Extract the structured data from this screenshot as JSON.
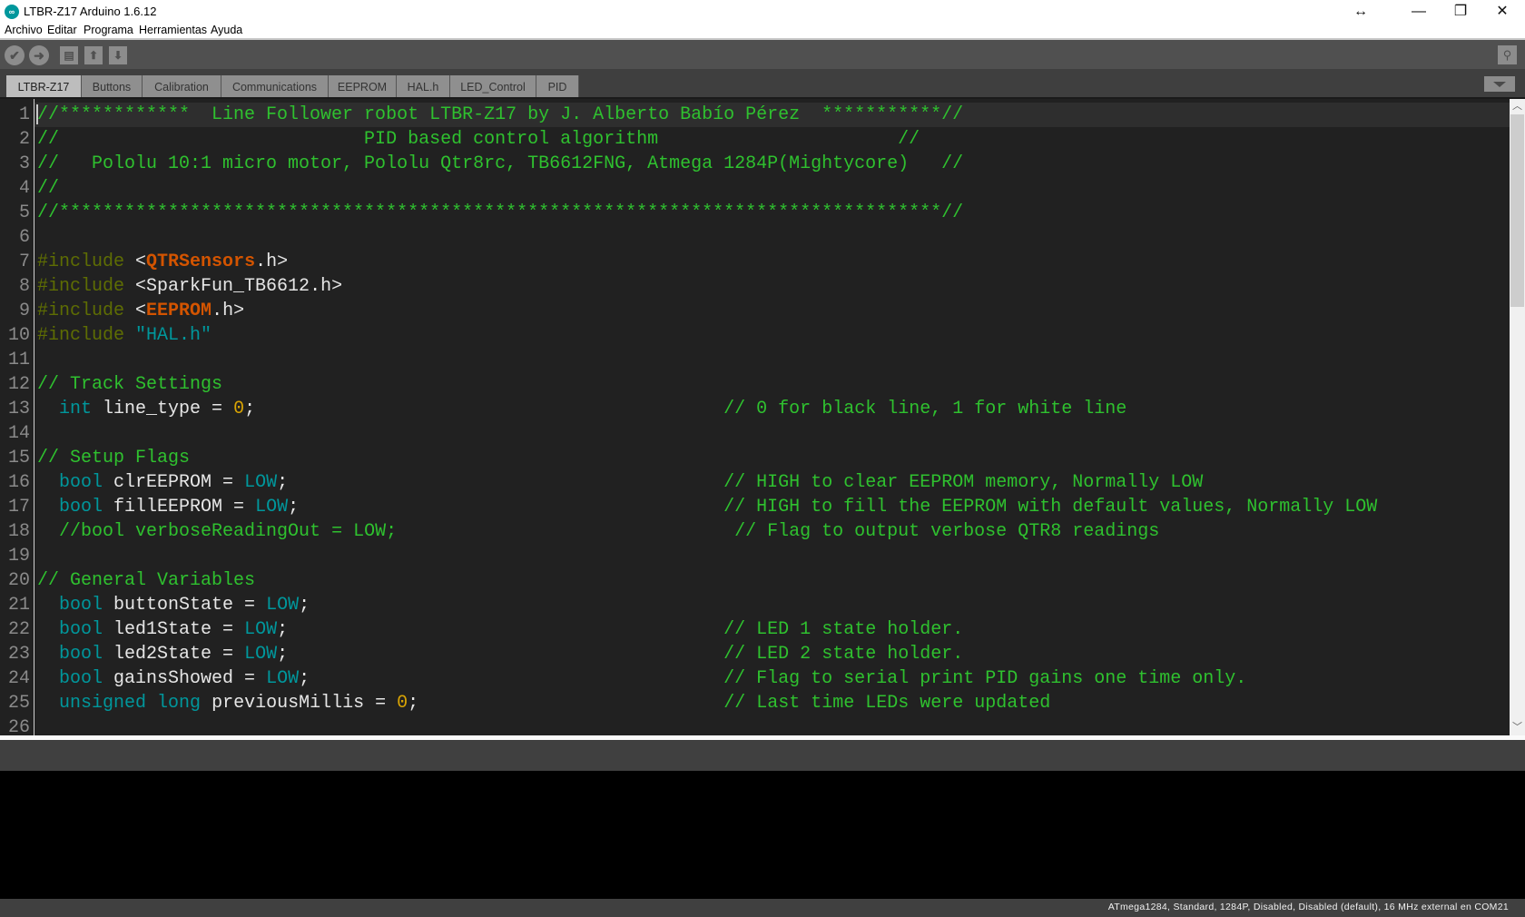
{
  "window": {
    "title": "LTBR-Z17 Arduino 1.6.12",
    "app_icon": "arduino-logo-icon",
    "controls": {
      "resize": "↔",
      "minimize": "—",
      "maximize": "❐",
      "close": "✕"
    }
  },
  "menubar": {
    "items": [
      "Archivo",
      "Editar",
      "Programa",
      "Herramientas",
      "Ayuda"
    ]
  },
  "toolbar": {
    "verify": "✔",
    "upload": "➜",
    "new": "▤",
    "open": "⬆",
    "save": "⬇",
    "serial_monitor": "⚲"
  },
  "tabs": [
    {
      "label": "LTBR-Z17",
      "active": true
    },
    {
      "label": "Buttons"
    },
    {
      "label": "Calibration"
    },
    {
      "label": "Communications"
    },
    {
      "label": "EEPROM"
    },
    {
      "label": "HAL.h"
    },
    {
      "label": "LED_Control"
    },
    {
      "label": "PID"
    }
  ],
  "editor": {
    "line_numbers": [
      "1",
      "2",
      "3",
      "4",
      "5",
      "6",
      "7",
      "8",
      "9",
      "10",
      "11",
      "12",
      "13",
      "14",
      "15",
      "16",
      "17",
      "18",
      "19",
      "20",
      "21",
      "22",
      "23",
      "24",
      "25",
      "26"
    ],
    "lines": [
      [
        [
          "comment",
          "//************  Line Follower robot LTBR-Z17 by J. Alberto Babío Pérez  ***********//"
        ]
      ],
      [
        [
          "comment",
          "//                            PID based control algorithm                      //"
        ]
      ],
      [
        [
          "comment",
          "//   Pololu 10:1 micro motor, Pololu Qtr8rc, TB6612FNG, Atmega 1284P(Mightycore)   //"
        ]
      ],
      [
        [
          "comment",
          "//"
        ]
      ],
      [
        [
          "comment",
          "//*********************************************************************************//"
        ]
      ],
      [],
      [
        [
          "pre",
          "#include "
        ],
        [
          "punct",
          "<"
        ],
        [
          "lib",
          "QTRSensors"
        ],
        [
          "punct",
          ".h>"
        ]
      ],
      [
        [
          "pre",
          "#include "
        ],
        [
          "punct",
          "<SparkFun_TB6612.h>"
        ]
      ],
      [
        [
          "pre",
          "#include "
        ],
        [
          "punct",
          "<"
        ],
        [
          "lib",
          "EEPROM"
        ],
        [
          "punct",
          ".h>"
        ]
      ],
      [
        [
          "pre",
          "#include "
        ],
        [
          "str",
          "\"HAL.h\""
        ]
      ],
      [],
      [
        [
          "comment",
          "// Track Settings"
        ]
      ],
      [
        [
          "punct",
          "  "
        ],
        [
          "kw",
          "int"
        ],
        [
          "id",
          " line_type = "
        ],
        [
          "num",
          "0"
        ],
        [
          "punct",
          ";                                           "
        ],
        [
          "comment",
          "// 0 for black line, 1 for white line"
        ]
      ],
      [],
      [
        [
          "comment",
          "// Setup Flags"
        ]
      ],
      [
        [
          "punct",
          "  "
        ],
        [
          "kw",
          "bool"
        ],
        [
          "id",
          " clrEEPROM = "
        ],
        [
          "kw",
          "LOW"
        ],
        [
          "punct",
          ";                                        "
        ],
        [
          "comment",
          "// HIGH to clear EEPROM memory, Normally LOW"
        ]
      ],
      [
        [
          "punct",
          "  "
        ],
        [
          "kw",
          "bool"
        ],
        [
          "id",
          " fillEEPROM = "
        ],
        [
          "kw",
          "LOW"
        ],
        [
          "punct",
          ";                                       "
        ],
        [
          "comment",
          "// HIGH to fill the EEPROM with default values, Normally LOW"
        ]
      ],
      [
        [
          "punct",
          "  "
        ],
        [
          "comment",
          "//bool verboseReadingOut = LOW;                               // Flag to output verbose QTR8 readings"
        ]
      ],
      [],
      [
        [
          "comment",
          "// General Variables"
        ]
      ],
      [
        [
          "punct",
          "  "
        ],
        [
          "kw",
          "bool"
        ],
        [
          "id",
          " buttonState = "
        ],
        [
          "kw",
          "LOW"
        ],
        [
          "punct",
          ";"
        ]
      ],
      [
        [
          "punct",
          "  "
        ],
        [
          "kw",
          "bool"
        ],
        [
          "id",
          " led1State = "
        ],
        [
          "kw",
          "LOW"
        ],
        [
          "punct",
          ";                                        "
        ],
        [
          "comment",
          "// LED 1 state holder."
        ]
      ],
      [
        [
          "punct",
          "  "
        ],
        [
          "kw",
          "bool"
        ],
        [
          "id",
          " led2State = "
        ],
        [
          "kw",
          "LOW"
        ],
        [
          "punct",
          ";                                        "
        ],
        [
          "comment",
          "// LED 2 state holder."
        ]
      ],
      [
        [
          "punct",
          "  "
        ],
        [
          "kw",
          "bool"
        ],
        [
          "id",
          " gainsShowed = "
        ],
        [
          "kw",
          "LOW"
        ],
        [
          "punct",
          ";                                      "
        ],
        [
          "comment",
          "// Flag to serial print PID gains one time only."
        ]
      ],
      [
        [
          "punct",
          "  "
        ],
        [
          "kw",
          "unsigned"
        ],
        [
          "punct",
          " "
        ],
        [
          "kw",
          "long"
        ],
        [
          "id",
          " previousMillis = "
        ],
        [
          "num",
          "0"
        ],
        [
          "punct",
          ";                            "
        ],
        [
          "comment",
          "// Last time LEDs were updated"
        ]
      ],
      []
    ]
  },
  "scrollbar": {
    "up": "︿",
    "down": "﹀",
    "position_fraction": 0.0
  },
  "status_bar": {
    "board_info": "ATmega1284, Standard, 1284P, Disabled, Disabled (default), 16 MHz external en COM21"
  },
  "colors": {
    "comment": "#2fc12f",
    "keyword": "#00979c",
    "preprocessor": "#5e6d03",
    "library": "#d35400",
    "number": "#d9a404",
    "editor_bg": "#212121"
  }
}
